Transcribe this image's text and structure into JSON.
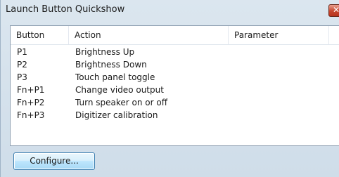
{
  "window": {
    "title": "Launch Button Quickshow",
    "close_label": "✕"
  },
  "table": {
    "columns": [
      "Button",
      "Action",
      "Parameter"
    ],
    "rows": [
      {
        "button": "P1",
        "action": "Brightness Up",
        "parameter": ""
      },
      {
        "button": "P2",
        "action": "Brightness Down",
        "parameter": ""
      },
      {
        "button": "P3",
        "action": "Touch panel toggle",
        "parameter": ""
      },
      {
        "button": "Fn+P1",
        "action": "Change video output",
        "parameter": ""
      },
      {
        "button": "Fn+P2",
        "action": "Turn speaker on or off",
        "parameter": ""
      },
      {
        "button": "Fn+P3",
        "action": "Digitizer calibration",
        "parameter": ""
      }
    ]
  },
  "footer": {
    "configure_label": "Configure..."
  },
  "colors": {
    "window_bg": "#d4e1ec",
    "close_button": "#c6452d",
    "button_border": "#3c7fb1"
  }
}
